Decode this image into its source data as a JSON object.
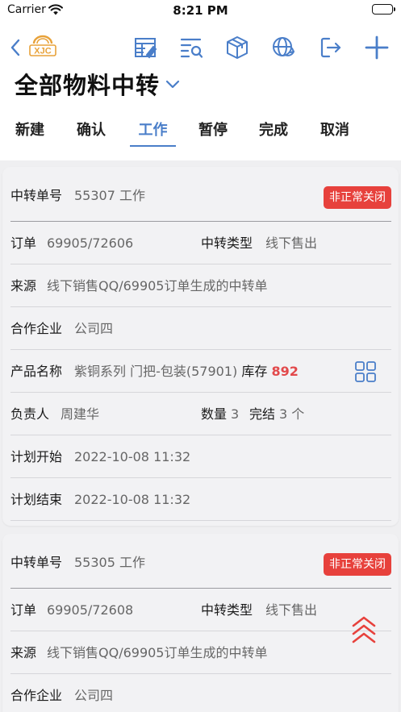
{
  "status_bar": {
    "carrier": "Carrier",
    "time": "8:21 PM"
  },
  "toolbar": {
    "back_icon": "chevron-left-icon",
    "logo_text": "XJC",
    "icons": [
      "table-edit-icon",
      "list-search-icon",
      "box-icon",
      "globe-sync-icon",
      "logout-icon",
      "plus-icon"
    ]
  },
  "header": {
    "title": "全部物料中转"
  },
  "tabs": [
    {
      "label": "新建"
    },
    {
      "label": "确认"
    },
    {
      "label": "工作",
      "active": true
    },
    {
      "label": "暂停"
    },
    {
      "label": "完成"
    },
    {
      "label": "取消"
    }
  ],
  "colors": {
    "accent": "#4a7ec9",
    "danger": "#e7413c",
    "stock": "#e2494b"
  },
  "cards": [
    {
      "transfer_no_label": "中转单号",
      "transfer_no": "55307 工作",
      "badge": "非正常关闭",
      "order_label": "订单",
      "order": "69905/72606",
      "type_label": "中转类型",
      "type": "线下售出",
      "source_label": "来源",
      "source": "线下销售QQ/69905订单生成的中转单",
      "partner_label": "合作企业",
      "partner": "公司四",
      "product_label": "产品名称",
      "product": "紫铜系列 门把-包装(57901)",
      "stock_label": "库存",
      "stock": "892",
      "owner_label": "负责人",
      "owner": "周建华",
      "qty_label": "数量",
      "qty": "3",
      "done_label": "完结",
      "done": "3 个",
      "plan_start_label": "计划开始",
      "plan_start": "2022-10-08 11:32",
      "plan_end_label": "计划结束",
      "plan_end": "2022-10-08 11:32"
    },
    {
      "transfer_no_label": "中转单号",
      "transfer_no": "55305 工作",
      "badge": "非正常关闭",
      "order_label": "订单",
      "order": "69905/72608",
      "type_label": "中转类型",
      "type": "线下售出",
      "source_label": "来源",
      "source": "线下销售QQ/69905订单生成的中转单",
      "partner_label": "合作企业",
      "partner": "公司四"
    }
  ]
}
